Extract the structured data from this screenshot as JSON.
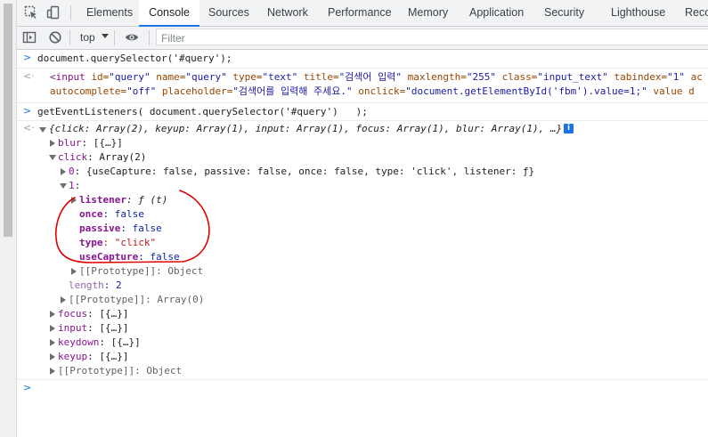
{
  "tabs": [
    "Elements",
    "Console",
    "Sources",
    "Network",
    "Performance",
    "Memory",
    "Application",
    "Security",
    "Lighthouse",
    "Reco"
  ],
  "active_tab": "Console",
  "toolbar": {
    "context": "top",
    "filter_placeholder": "Filter"
  },
  "console": {
    "cmd1": "document.querySelector('#query');",
    "out1": {
      "line1_start": "<input ",
      "id_a": "id=",
      "id_v": "\"query\"",
      "name_a": " name=",
      "name_v": "\"query\"",
      "type_a": " type=",
      "type_v": "\"text\"",
      "title_a": " title=",
      "title_v": "\"검색어 입력\"",
      "max_a": " maxlength=",
      "max_v": "\"255\"",
      "class_a": " class=",
      "class_v": "\"input_text\"",
      "tab_a": " tabindex=",
      "tab_v": "\"1\"",
      "ac_trunc": " ac",
      "line2_ac_a": "autocomplete=",
      "line2_ac_v": "\"off\"",
      "ph_a": " placeholder=",
      "ph_v": "\"검색어를 입력해 주세요.\"",
      "oc_a": " onclick=",
      "oc_v": "\"document.getElementById('fbm').value=1;\"",
      "val_trunc": " value d"
    },
    "cmd2": "getEventListeners( document.querySelector('#query')   );",
    "summary": "{click: Array(2), keyup: Array(1), input: Array(1), focus: Array(1), blur: Array(1), …}",
    "info_badge": "i",
    "tree": {
      "blur_k": "blur",
      "blur_v": ": [{…}]",
      "click_k": "click",
      "click_v": ": Array(2)",
      "item0_k": "0",
      "item0_v": ": {useCapture: false, passive: false, once: false, type: 'click', listener: ƒ}",
      "item1_k": "1",
      "item1_v": ":",
      "listener_k": "listener",
      "listener_v": ": ƒ (t)",
      "once_k": "once",
      "once_v": ": false",
      "passive_k": "passive",
      "passive_v": ": false",
      "type_k": "type",
      "type_v": ": \"click\"",
      "uc_k": "useCapture",
      "uc_v": ": false",
      "proto1": "[[Prototype]]: Object",
      "length_k": "length",
      "length_v": ": 2",
      "proto2": "[[Prototype]]: Array(0)",
      "focus_k": "focus",
      "focus_v": ": [{…}]",
      "input_k": "input",
      "input_v": ": [{…}]",
      "keydown_k": "keydown",
      "keydown_v": ": [{…}]",
      "keyup_k": "keyup",
      "keyup_v": ": [{…}]",
      "proto3": "[[Prototype]]: Object"
    }
  },
  "prompt_glyph": ">",
  "result_glyph": "<·",
  "colors": {
    "accent": "#1a73e8",
    "annotation": "#e00000"
  }
}
